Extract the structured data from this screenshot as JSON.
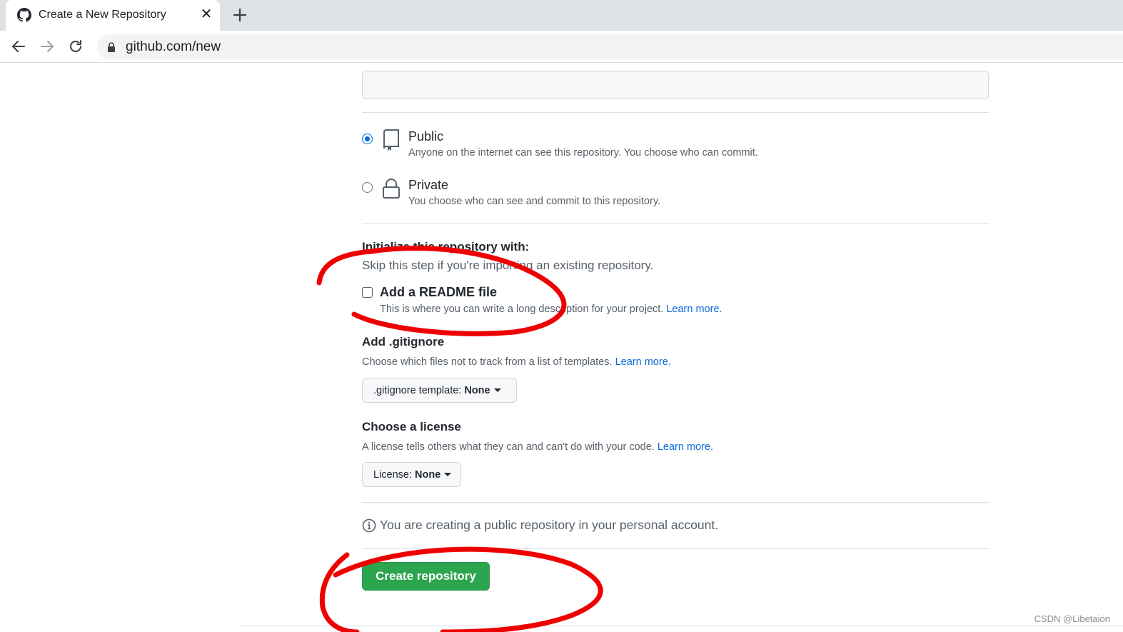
{
  "browser": {
    "tab_title": "Create a New Repository",
    "tab_close": "✕",
    "url": "github.com/new"
  },
  "visibility": {
    "public_title": "Public",
    "public_desc": "Anyone on the internet can see this repository. You choose who can commit.",
    "public_selected": true,
    "private_title": "Private",
    "private_desc": "You choose who can see and commit to this repository."
  },
  "initialize": {
    "heading": "Initialize this repository with:",
    "subtext": "Skip this step if you're importing an existing repository.",
    "readme_label": "Add a README file",
    "readme_checked": false,
    "readme_desc": "This is where you can write a long description for your project.",
    "readme_link": "Learn more."
  },
  "gitignore": {
    "heading": "Add .gitignore",
    "desc": "Choose which files not to track from a list of templates.",
    "link": "Learn more.",
    "select_prefix": ".gitignore template:",
    "select_value": "None"
  },
  "license": {
    "heading": "Choose a license",
    "desc": "A license tells others what they can and can't do with your code.",
    "link": "Learn more.",
    "select_prefix": "License:",
    "select_value": "None"
  },
  "info": {
    "text": "You are creating a public repository in your personal account."
  },
  "actions": {
    "create_label": "Create repository"
  },
  "watermark": "CSDN @Libetaion",
  "colors": {
    "accent_blue": "#0969da",
    "button_green": "#2da44e",
    "annotation_red": "#ee0000"
  }
}
